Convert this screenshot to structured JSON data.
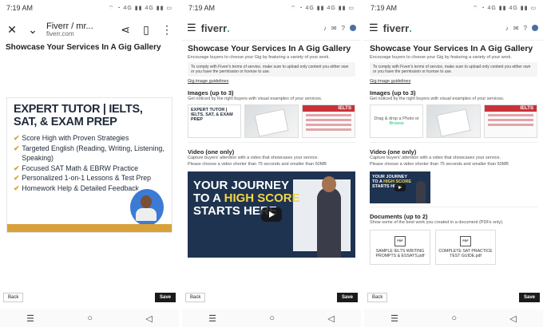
{
  "status": {
    "time": "7:19 AM",
    "icons": "⌔ ◔ 4G ▮▮ 4G ▮▮ ▭"
  },
  "panel1": {
    "page_title": "Fiverr / mr...",
    "url": "fiverr.com",
    "heading": "Showcase Your Services In A Gig Gallery",
    "banner": {
      "title": "EXPERT TUTOR | IELTS, SAT, & EXAM PREP",
      "bullets": [
        "Score High with Proven Strategies",
        "Targeted English (Reading, Writing, Listening, Speaking)",
        "Focused SAT Math & EBRW Practice",
        "Personalized 1-on-1 Lessons & Test Prep",
        "Homework Help & Detailed Feedback"
      ],
      "check": "✔"
    }
  },
  "app": {
    "brand": "fiverr",
    "brand_dot": ".",
    "heading": "Showcase Your Services In A Gig Gallery",
    "subheading": "Encourage buyers to choose your Gig by featuring a variety of your work.",
    "notice": "To comply with Fiverr's terms of service, make sure to upload only content you either own or you have the permission or license to use.",
    "guidelines_link": "Gig image guidelines",
    "images_title": "Images (up to 3)",
    "images_sub": "Get noticed by the right buyers with visual examples of your services.",
    "drag_text": "Drag & drop a Photo or",
    "browse": "Browse",
    "thumb_tutor": "EXPERT TUTOR | IELTS, SAT, & EXAM PREP",
    "thumb_ielts": "IELTS",
    "video_title": "Video (one only)",
    "video_sub": "Capture buyers' attention with a video that showcases your service.",
    "video_sub2": "Please choose a video shorter than 75 seconds and smaller than 50MB",
    "video_line1": "YOUR JOURNEY",
    "video_line2a": "TO A",
    "video_line2b": "HIGH SCORE",
    "video_line3": "STARTS HERE",
    "docs_title": "Documents (up to 2)",
    "docs_sub": "Show some of the best work you created in a document (PDFs only).",
    "pdf_label": "PDF",
    "doc1": "SAMPLE IELTS WRITING PROMPTS & ESSAYS.pdf",
    "doc2": "COMPLETE SAT PRACTICE TEST GUIDE.pdf",
    "back": "Back",
    "save": "Save"
  },
  "icons": {
    "close": "✕",
    "chevron": "⌄",
    "share": "⋖",
    "bookmark": "▯",
    "more": "⋮",
    "menu": "☰",
    "bell": "♪",
    "mail": "✉",
    "help": "?",
    "nav_menu": "☰",
    "nav_home": "○",
    "nav_back": "◁"
  },
  "colors": {
    "brand_green": "#1dbf73",
    "save_button": "#1b1b1b",
    "accent_gold": "#d8a13a"
  }
}
